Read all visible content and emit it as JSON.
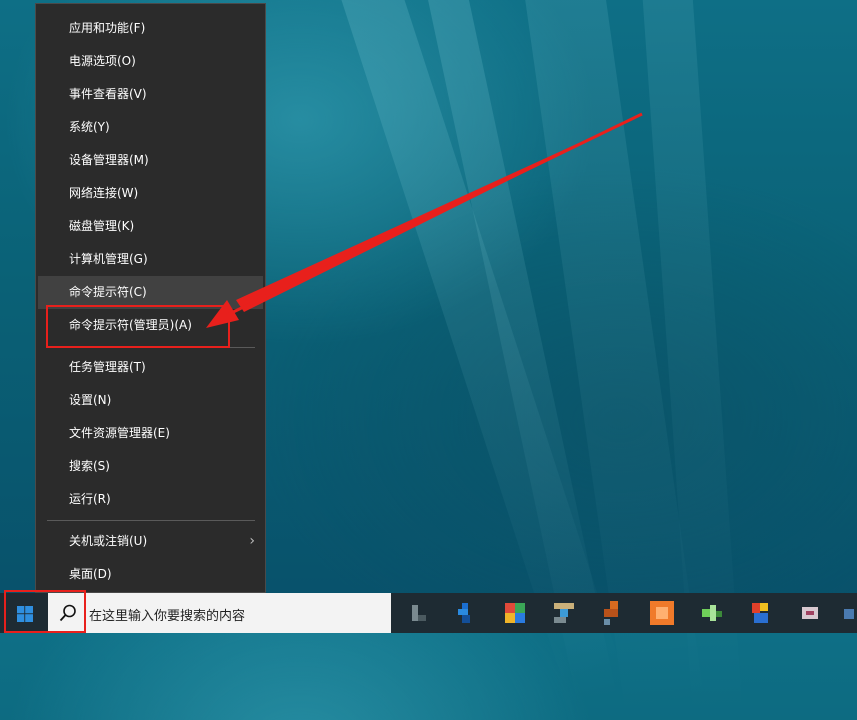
{
  "context_menu": {
    "items": [
      {
        "label": "应用和功能(F)"
      },
      {
        "label": "电源选项(O)"
      },
      {
        "label": "事件查看器(V)"
      },
      {
        "label": "系统(Y)"
      },
      {
        "label": "设备管理器(M)"
      },
      {
        "label": "网络连接(W)"
      },
      {
        "label": "磁盘管理(K)"
      },
      {
        "label": "计算机管理(G)"
      },
      {
        "label": "命令提示符(C)"
      },
      {
        "label": "命令提示符(管理员)(A)"
      },
      {
        "label": "任务管理器(T)"
      },
      {
        "label": "设置(N)"
      },
      {
        "label": "文件资源管理器(E)"
      },
      {
        "label": "搜索(S)"
      },
      {
        "label": "运行(R)"
      },
      {
        "label": "关机或注销(U)"
      },
      {
        "label": "桌面(D)"
      }
    ],
    "highlighted_item": "命令提示符(C)"
  },
  "taskbar": {
    "search_placeholder": "在这里输入你要搜索的内容",
    "start_icon": "windows-logo-icon",
    "search_icon": "search-icon",
    "pinned_apps": [
      "app-icon-1",
      "app-icon-2",
      "app-icon-3",
      "app-icon-4",
      "app-icon-5",
      "app-icon-6",
      "app-icon-7",
      "app-icon-8",
      "app-icon-9",
      "app-icon-10"
    ]
  },
  "annotation": {
    "color": "#e8201c"
  }
}
